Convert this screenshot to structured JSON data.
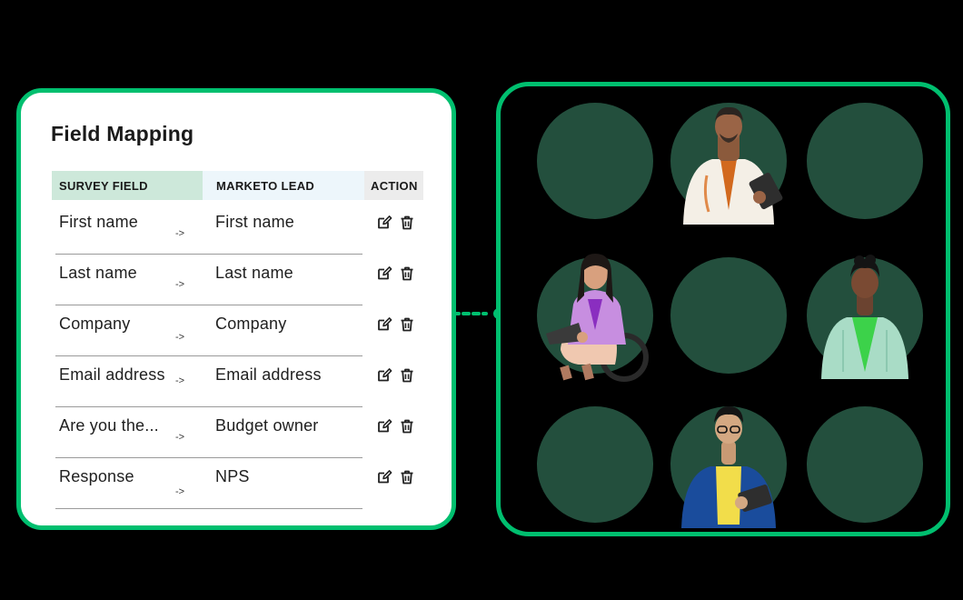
{
  "card": {
    "title": "Field Mapping",
    "headers": {
      "survey": "SURVEY FIELD",
      "marketo": "MARKETO LEAD",
      "action": "ACTION"
    },
    "rows": [
      {
        "survey": "First name",
        "arrow": "->",
        "marketo": "First name"
      },
      {
        "survey": "Last name",
        "arrow": "->",
        "marketo": "Last name"
      },
      {
        "survey": "Company",
        "arrow": "->",
        "marketo": "Company"
      },
      {
        "survey": "Email address",
        "arrow": "->",
        "marketo": "Email address"
      },
      {
        "survey": "Are you the...",
        "arrow": "->",
        "marketo": "Budget owner"
      },
      {
        "survey": "Response",
        "arrow": "->",
        "marketo": "NPS"
      }
    ],
    "action_icons": [
      "edit-icon",
      "trash-icon"
    ]
  },
  "panel": {
    "grid": [
      [
        "empty",
        "person-man-tablet",
        "empty"
      ],
      [
        "person-woman-laptop-wheelchair",
        "empty",
        "person-woman-mint-jacket"
      ],
      [
        "empty",
        "person-man-yellow-tablet",
        "empty"
      ]
    ]
  },
  "colors": {
    "accent_green": "#00bf6f",
    "dot_green": "#234f3d",
    "header_survey_bg": "#cde8da",
    "header_marketo_bg": "#edf6fb",
    "header_action_bg": "#ececec",
    "background": "#000000"
  }
}
